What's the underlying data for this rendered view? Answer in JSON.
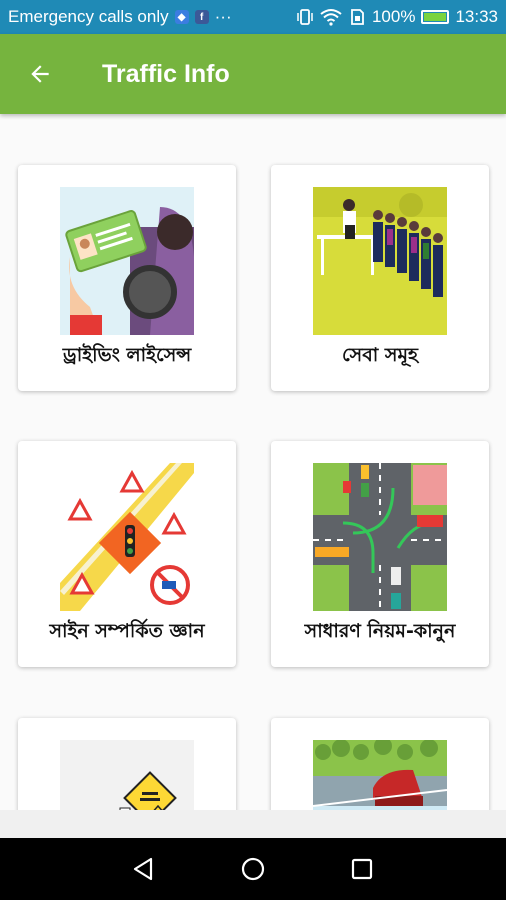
{
  "status_bar": {
    "carrier": "Emergency calls only",
    "battery": "100%",
    "time": "13:33",
    "notification_icons": [
      "app-icon",
      "facebook-icon",
      "more-icon"
    ],
    "system_icons": [
      "vibrate-icon",
      "wifi-icon",
      "sim-icon",
      "battery-icon"
    ]
  },
  "app_bar": {
    "title": "Traffic Info",
    "back_icon": "arrow-back-icon",
    "color": "#76b43e"
  },
  "cards": [
    {
      "label": "ড্রাইভিং লাইসেন্স",
      "icon": "driving-license-illustration"
    },
    {
      "label": "সেবা সমূহ",
      "icon": "services-queue-illustration"
    },
    {
      "label": "সাইন সম্পর্কিত জ্ঞান",
      "icon": "traffic-signs-illustration"
    },
    {
      "label": "সাধারণ নিয়ম-কানুন",
      "icon": "road-intersection-illustration"
    },
    {
      "label": "",
      "icon": "warning-sign-illustration"
    },
    {
      "label": "",
      "icon": "road-scene-illustration"
    }
  ],
  "nav_bar": {
    "icons": [
      "back-triangle-icon",
      "home-circle-icon",
      "recents-square-icon"
    ]
  },
  "colors": {
    "status_bar": "#1f8ab6",
    "app_bar": "#76b43e",
    "background": "#fafafa"
  }
}
